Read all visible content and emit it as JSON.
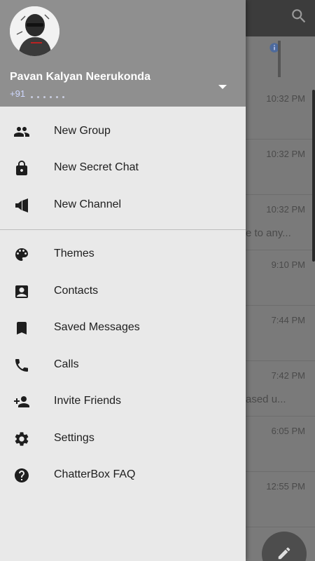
{
  "background": {
    "chat_rows": [
      {
        "time": "10:32 PM",
        "snippet": ""
      },
      {
        "time": "10:32 PM",
        "snippet": ""
      },
      {
        "time": "10:32 PM",
        "snippet": "e to any..."
      },
      {
        "time": "9:10 PM",
        "snippet": ""
      },
      {
        "time": "7:44 PM",
        "snippet": ""
      },
      {
        "time": "7:42 PM",
        "snippet": "ased u..."
      },
      {
        "time": "6:05 PM",
        "snippet": ""
      },
      {
        "time": "12:55 PM",
        "snippet": ""
      }
    ]
  },
  "profile": {
    "name": "Pavan Kalyan Neerukonda",
    "phone_prefix": "+91"
  },
  "menu": {
    "new_group": "New Group",
    "new_secret_chat": "New Secret Chat",
    "new_channel": "New Channel",
    "themes": "Themes",
    "contacts": "Contacts",
    "saved_messages": "Saved Messages",
    "calls": "Calls",
    "invite_friends": "Invite Friends",
    "settings": "Settings",
    "faq": "ChatterBox FAQ"
  },
  "icons": {
    "new_group": "group-icon",
    "new_secret_chat": "lock-icon",
    "new_channel": "megaphone-icon",
    "themes": "palette-icon",
    "contacts": "contact-card-icon",
    "saved_messages": "bookmark-icon",
    "calls": "phone-icon",
    "invite_friends": "add-person-icon",
    "settings": "gear-icon",
    "faq": "help-icon"
  },
  "colors": {
    "header_bg": "#8f8f8f",
    "drawer_bg": "#e9e9e9",
    "icon": "#1e1e1e",
    "text": "#1e1e1e"
  }
}
